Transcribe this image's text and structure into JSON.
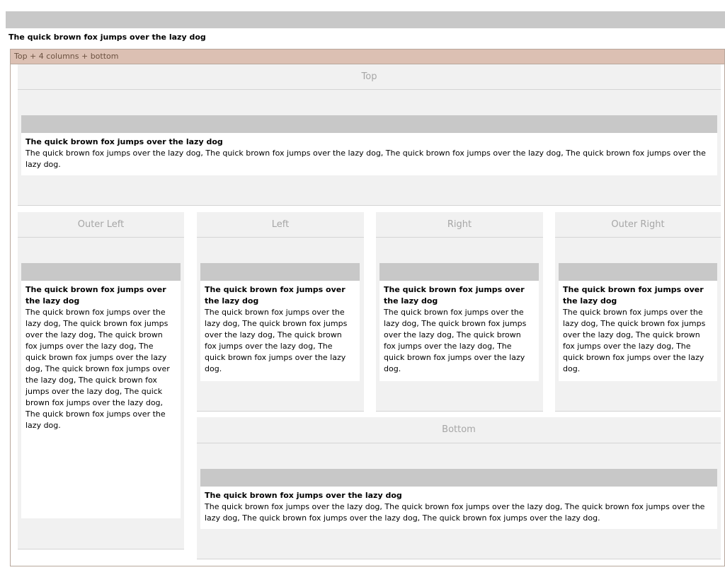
{
  "page": {
    "title": "The quick brown fox jumps over the lazy dog"
  },
  "layout": {
    "label": "Top + 4 columns + bottom"
  },
  "regions": {
    "top": {
      "label": "Top",
      "portlet": {
        "title": "The quick brown fox jumps over the lazy dog",
        "text": "The quick brown fox jumps over the lazy dog, The quick brown fox jumps over the lazy dog, The quick brown fox jumps over the lazy dog, The quick brown fox jumps over the lazy dog."
      }
    },
    "outer_left": {
      "label": "Outer Left",
      "portlet": {
        "title": "The quick brown fox jumps over the lazy dog",
        "text": "The quick brown fox jumps over the lazy dog, The quick brown fox jumps over the lazy dog, The quick brown fox jumps over the lazy dog, The quick brown fox jumps over the lazy dog, The quick brown fox jumps over the lazy dog, The quick brown fox jumps over the lazy dog, The quick brown fox jumps over the lazy dog, The quick brown fox jumps over the lazy dog."
      }
    },
    "left": {
      "label": "Left",
      "portlet": {
        "title": "The quick brown fox jumps over the lazy dog",
        "text": "The quick brown fox jumps over the lazy dog, The quick brown fox jumps over the lazy dog, The quick brown fox jumps over the lazy dog, The quick brown fox jumps over the lazy dog."
      }
    },
    "right": {
      "label": "Right",
      "portlet": {
        "title": "The quick brown fox jumps over the lazy dog",
        "text": "The quick brown fox jumps over the lazy dog, The quick brown fox jumps over the lazy dog, The quick brown fox jumps over the lazy dog, The quick brown fox jumps over the lazy dog."
      }
    },
    "outer_right": {
      "label": "Outer Right",
      "portlet": {
        "title": "The quick brown fox jumps over the lazy dog",
        "text": "The quick brown fox jumps over the lazy dog, The quick brown fox jumps over the lazy dog, The quick brown fox jumps over the lazy dog, The quick brown fox jumps over the lazy dog."
      }
    },
    "bottom": {
      "label": "Bottom",
      "portlet": {
        "title": "The quick brown fox jumps over the lazy dog",
        "text": "The quick brown fox jumps over the lazy dog, The quick brown fox jumps over the lazy dog, The quick brown fox jumps over the lazy dog, The quick brown fox jumps over the lazy dog, The quick brown fox jumps over the lazy dog."
      }
    }
  }
}
